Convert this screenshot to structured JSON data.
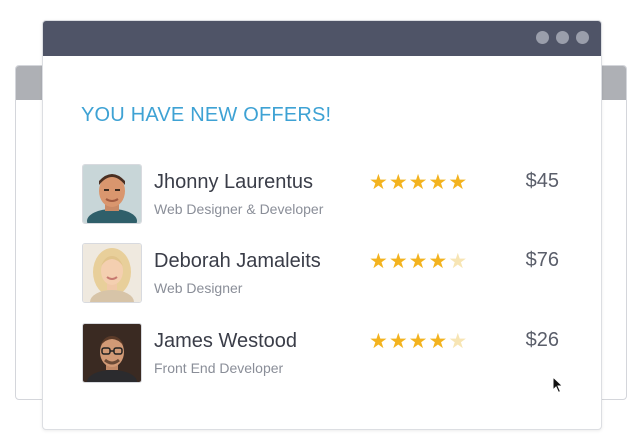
{
  "heading": "YOU HAVE NEW OFFERS!",
  "colors": {
    "accent": "#3ea2d4",
    "titlebar": "#4f5467",
    "star": "#f3b31f"
  },
  "offers": [
    {
      "name": "Jhonny Laurentus",
      "role": "Web Designer & Developer",
      "rating": 5,
      "price": "$45"
    },
    {
      "name": "Deborah Jamaleits",
      "role": "Web Designer",
      "rating": 4,
      "price": "$76"
    },
    {
      "name": "James Westood",
      "role": "Front End Developer",
      "rating": 4,
      "price": "$26"
    }
  ],
  "window_controls": [
    "dot",
    "dot",
    "dot"
  ],
  "icons": {
    "star": "star-icon",
    "cursor": "mouse-pointer-icon"
  }
}
